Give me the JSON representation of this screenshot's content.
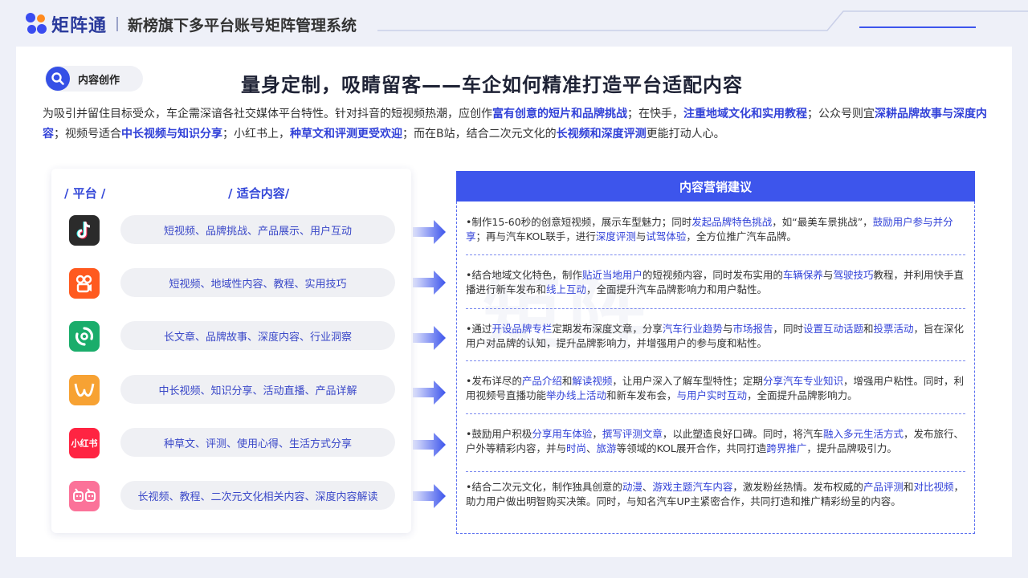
{
  "header": {
    "logo_text": "矩阵通",
    "title": "新榜旗下多平台账号矩阵管理系统"
  },
  "badge": {
    "label": "内容创作",
    "icon": "search-icon"
  },
  "main_title": "量身定制，吸睛留客——车企如何精准打造平台适配内容",
  "intro": {
    "t1": "为吸引并留住目标受众，车企需深谙各社交媒体平台特性。针对抖音的短视频热潮，应创作",
    "h1": "富有创意的短片和品牌挑战",
    "t2": "；在快手，",
    "h2": "注重地域文化和实用教程",
    "t3": "；公众号则宜",
    "h3": "深耕品牌故事与深度内容",
    "t4": "；视频号适合",
    "h4": "中长视频与知识分享",
    "t5": "；小红书上，",
    "h5": "种草文和评测更受欢迎",
    "t6": "；而在B站，结合二次元文化的",
    "h6": "长视频和深度评测",
    "t7": "更能打动人心。"
  },
  "left": {
    "col_platform": "/ 平台 /",
    "col_content": "/ 适合内容/",
    "platforms": [
      {
        "icon": "douyin-icon",
        "color": "#2b2b2b",
        "content": "短视频、品牌挑战、产品展示、用户互动"
      },
      {
        "icon": "kuaishou-icon",
        "color": "#ff5a1f",
        "content": "短视频、地域性内容、教程、实用技巧"
      },
      {
        "icon": "wechat-official-icon",
        "color": "#1aad6b",
        "content": "长文章、品牌故事、深度内容、行业洞察"
      },
      {
        "icon": "wechat-channels-icon",
        "color": "#f7a233",
        "content": "中长视频、知识分享、活动直播、产品详解"
      },
      {
        "icon": "xiaohongshu-icon",
        "color": "#ff2442",
        "label": "小红书",
        "content": "种草文、评测、使用心得、生活方式分享"
      },
      {
        "icon": "bilibili-icon",
        "color": "#fb7299",
        "content": "长视频、教程、二次元文化相关内容、深度内容解读"
      }
    ]
  },
  "right": {
    "heading": "内容营销建议",
    "advice": [
      [
        {
          "t": "•制作15-60秒的创意短视频，展示车型魅力；同时"
        },
        {
          "h": "发起品牌特色挑战"
        },
        {
          "t": "，如“最美车景挑战”，"
        },
        {
          "h": "鼓励用户参与并分享"
        },
        {
          "t": "；再与汽车KOL联手，进行"
        },
        {
          "h": "深度评测"
        },
        {
          "t": "与"
        },
        {
          "h": "试驾体验"
        },
        {
          "t": "，全方位推广汽车品牌。"
        }
      ],
      [
        {
          "t": "•结合地域文化特色，制作"
        },
        {
          "h": "贴近当地用户"
        },
        {
          "t": "的短视频内容，同时发布实用的"
        },
        {
          "h": "车辆保养"
        },
        {
          "t": "与"
        },
        {
          "h": "驾驶技巧"
        },
        {
          "t": "教程，并利用快手直播进行新车发布和"
        },
        {
          "h": "线上互动"
        },
        {
          "t": "，全面提升汽车品牌影响力和用户黏性。"
        }
      ],
      [
        {
          "t": "•通过"
        },
        {
          "h": "开设品牌专栏"
        },
        {
          "t": "定期发布深度文章，分享"
        },
        {
          "h": "汽车行业趋势"
        },
        {
          "t": "与"
        },
        {
          "h": "市场报告"
        },
        {
          "t": "，同时"
        },
        {
          "h": "设置互动话题"
        },
        {
          "t": "和"
        },
        {
          "h": "投票活动"
        },
        {
          "t": "，旨在深化用户对品牌的认知，提升品牌影响力，并增强用户的参与度和粘性。"
        }
      ],
      [
        {
          "t": "•发布详尽的"
        },
        {
          "h": "产品介绍"
        },
        {
          "t": "和"
        },
        {
          "h": "解读视频"
        },
        {
          "t": "，让用户深入了解车型特性；定期"
        },
        {
          "h": "分享汽车专业知识"
        },
        {
          "t": "，增强用户粘性。同时，利用视频号直播功能"
        },
        {
          "h": "举办线上活动"
        },
        {
          "t": "和新车发布会，"
        },
        {
          "h": "与用户实时互动"
        },
        {
          "t": "，全面提升品牌影响力。"
        }
      ],
      [
        {
          "t": "•鼓励用户积极"
        },
        {
          "h": "分享用车体验"
        },
        {
          "t": "，"
        },
        {
          "h": "撰写评测文章"
        },
        {
          "t": "，以此塑造良好口碑。同时，将汽车"
        },
        {
          "h": "融入多元生活方式"
        },
        {
          "t": "，发布旅行、户外等精彩内容，并与"
        },
        {
          "h": "时尚"
        },
        {
          "t": "、"
        },
        {
          "h": "旅游"
        },
        {
          "t": "等领域的KOL展开合作，共同打造"
        },
        {
          "h": "跨界推广"
        },
        {
          "t": "，提升品牌吸引力。"
        }
      ],
      [
        {
          "t": "•结合二次元文化，制作独具创意的"
        },
        {
          "h": "动漫"
        },
        {
          "t": "、"
        },
        {
          "h": "游戏主题汽车内容"
        },
        {
          "t": "，激发粉丝热情。发布权威的"
        },
        {
          "h": "产品评测"
        },
        {
          "t": "和"
        },
        {
          "h": "对比视频"
        },
        {
          "t": "，助力用户做出明智购买决策。同时，与知名汽车UP主紧密合作，共同打造和推广精彩纷呈的内容。"
        }
      ]
    ]
  },
  "colors": {
    "accent": "#3d55ec",
    "highlight": "#3242d8"
  }
}
